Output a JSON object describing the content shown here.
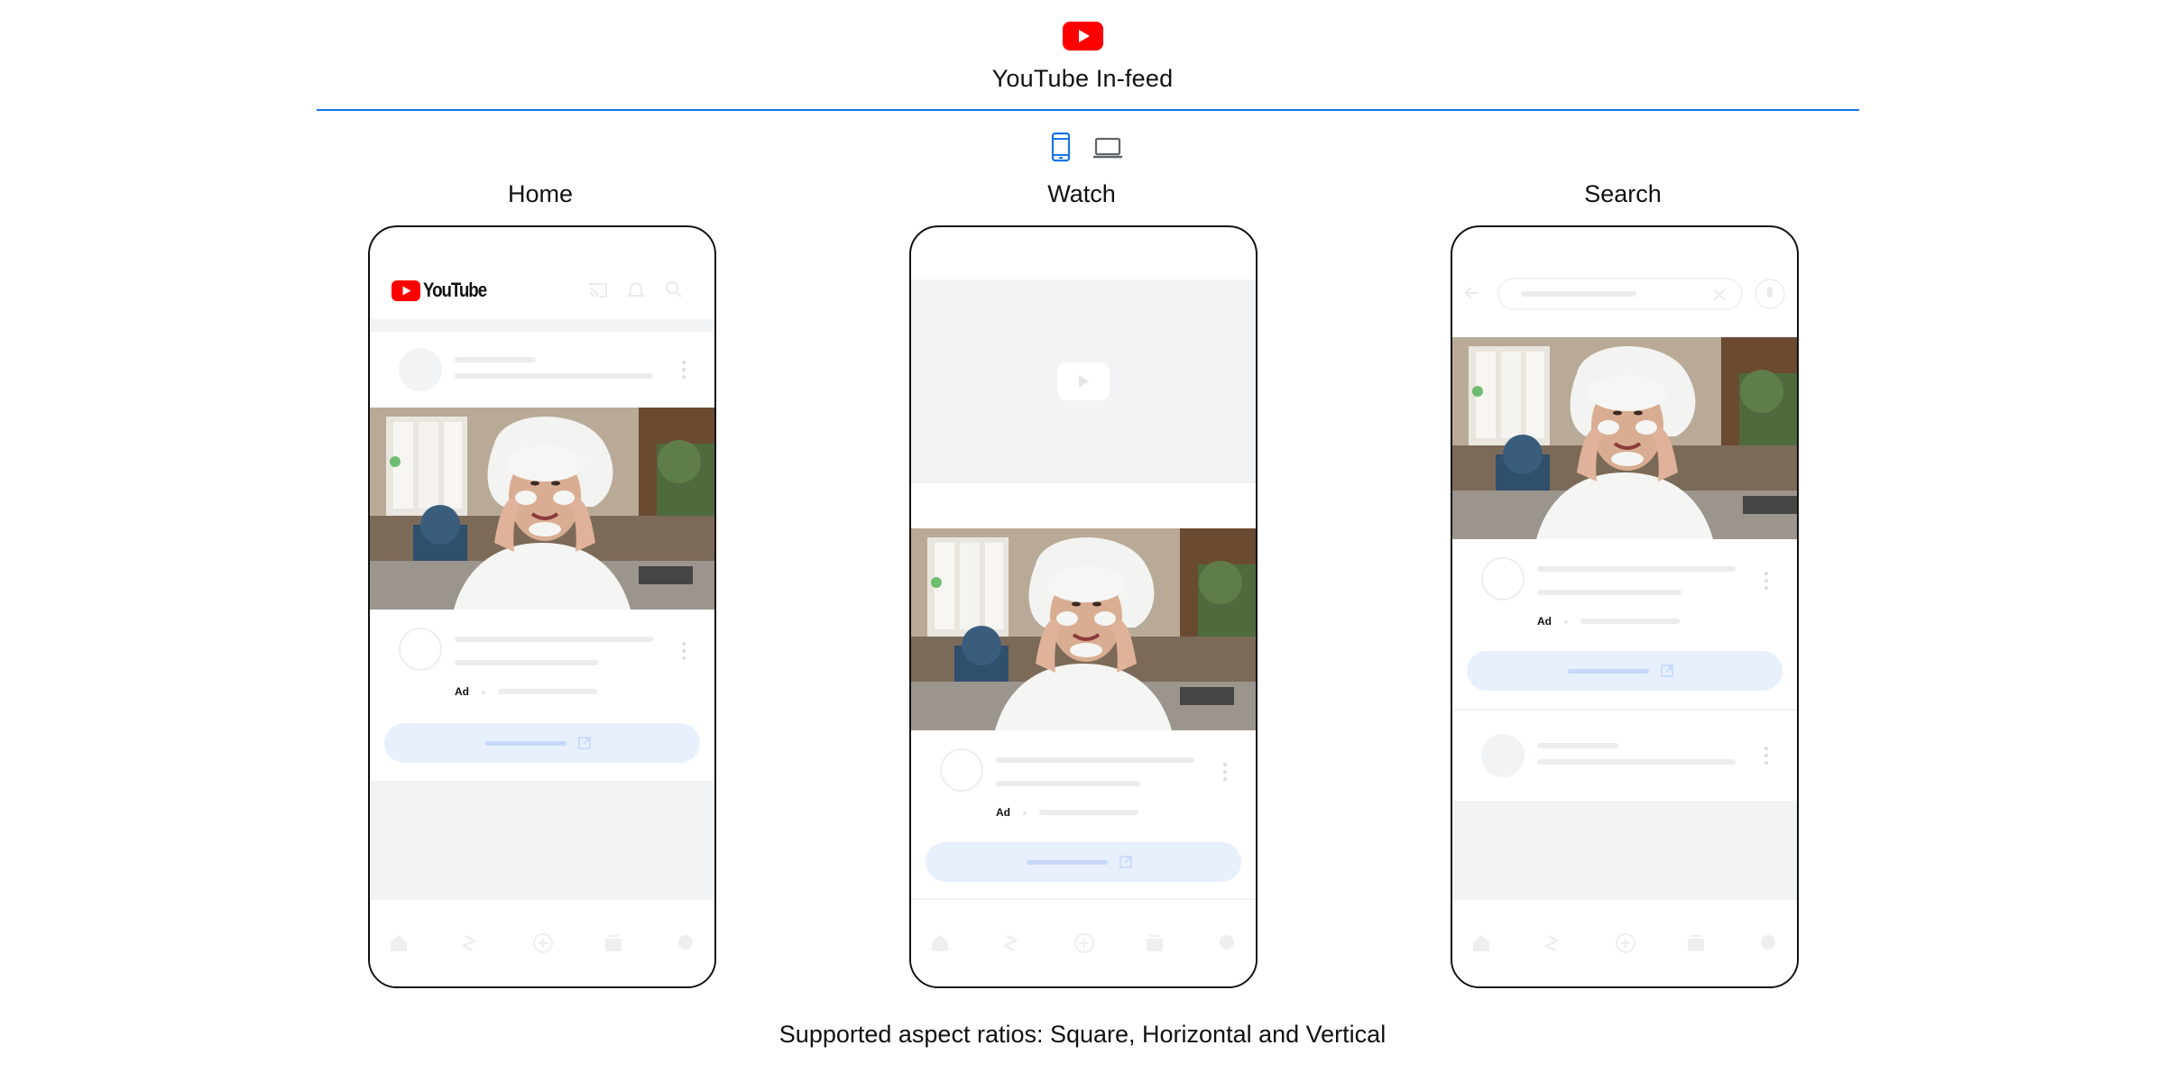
{
  "header": {
    "logo": "youtube-play-icon",
    "title": "YouTube In-feed"
  },
  "device_toggle": {
    "options": [
      "mobile",
      "desktop"
    ],
    "selected": "mobile"
  },
  "colors": {
    "accent": "#1a73e8",
    "youtube_red": "#ff0000",
    "cta_bg": "#e8f0fe",
    "placeholder_grey": "#f1f3f4"
  },
  "columns": [
    {
      "label": "Home",
      "app_wordmark": "YouTube",
      "ad_badge": "Ad"
    },
    {
      "label": "Watch",
      "ad_badge": "Ad"
    },
    {
      "label": "Search",
      "ad_badge": "Ad"
    }
  ],
  "footer": {
    "note": "Supported aspect ratios: Square, Horizontal and Vertical"
  }
}
